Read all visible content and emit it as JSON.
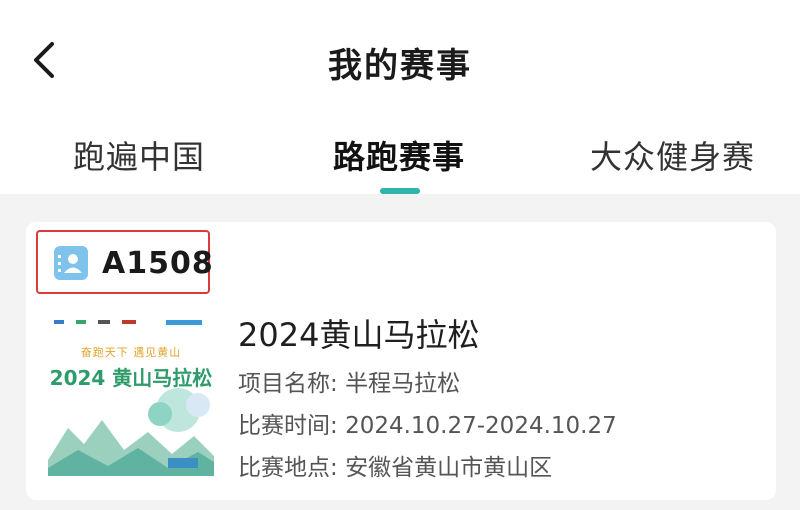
{
  "header": {
    "title": "我的赛事"
  },
  "tabs": [
    {
      "label": "跑遍中国",
      "active": false
    },
    {
      "label": "路跑赛事",
      "active": true
    },
    {
      "label": "大众健身赛",
      "active": false
    }
  ],
  "colors": {
    "accent": "#2fb3ad",
    "highlight_border": "#d93a3a",
    "code_icon": "#7ec3ec"
  },
  "event": {
    "code": "A1508",
    "code_icon": "contact-card-icon",
    "title": "2024黄山马拉松",
    "poster": {
      "slogan": "奋跑天下 遇见黄山",
      "name": "2024 黄山马拉松"
    },
    "fields": [
      {
        "label": "项目名称: ",
        "value": "半程马拉松"
      },
      {
        "label": "比赛时间: ",
        "value": "2024.10.27-2024.10.27"
      },
      {
        "label": "比赛地点: ",
        "value": "安徽省黄山市黄山区"
      }
    ]
  }
}
